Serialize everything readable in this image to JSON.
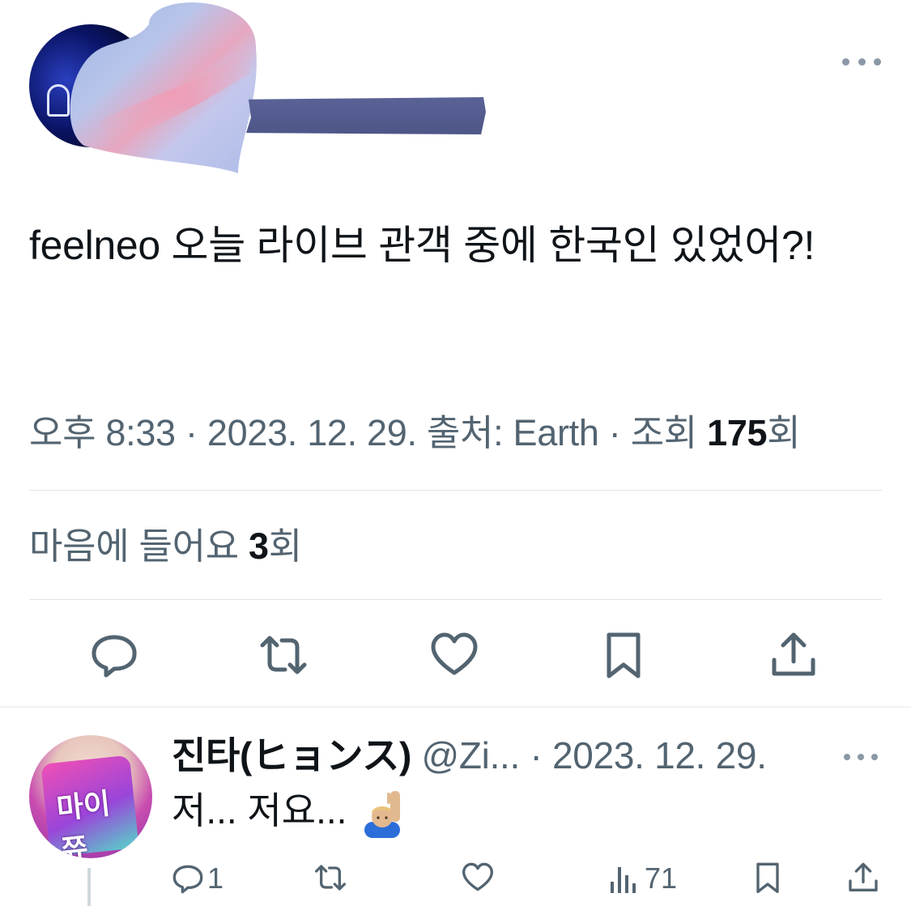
{
  "tweet": {
    "text": "feelneo 오늘 라이브 관객 중에 한국인 있었어?!",
    "time": "오후 8:33",
    "sep": "·",
    "date": "2023. 12. 29.",
    "source_label": "출처:",
    "source": "Earth",
    "views_label": "조회",
    "views": "175",
    "views_unit": "회",
    "likes_label": "마음에 들어요",
    "likes": "3",
    "likes_unit": "회"
  },
  "icons": {
    "more": "more-horizontal-icon",
    "reply": "speech-bubble-icon",
    "retweet": "retweet-icon",
    "like": "heart-icon",
    "bookmark": "bookmark-icon",
    "share": "share-upload-icon",
    "views": "bar-chart-icon"
  },
  "reply": {
    "name": "진타(ヒョンス)",
    "handle": "@Zi...",
    "sep": "·",
    "date": "2023. 12. 29.",
    "text": "저... 저요...",
    "avatar_text": "마이쮸",
    "reply_count": "1",
    "views_count": "71"
  },
  "colors": {
    "text": "#0f1419",
    "secondary": "#536471",
    "icon": "#536471",
    "divider": "#e1e5e9",
    "tape": "#555d90"
  }
}
